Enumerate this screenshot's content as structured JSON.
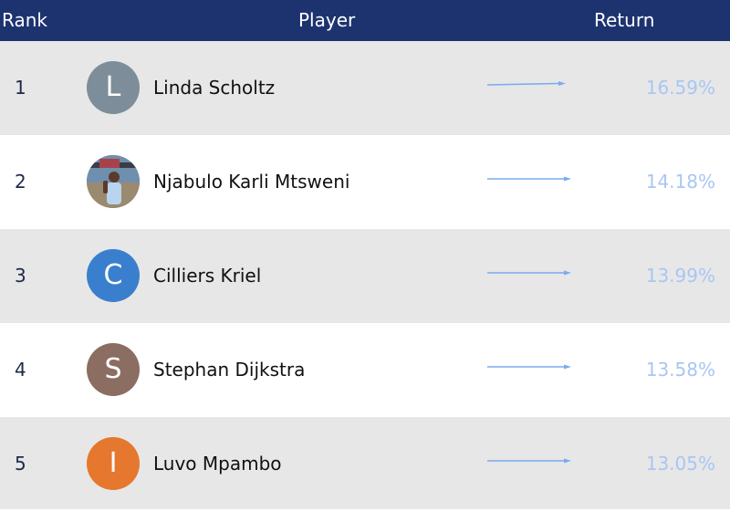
{
  "header": {
    "rank": "Rank",
    "player": "Player",
    "return": "Return"
  },
  "colors": {
    "header_bg": "#1d3370",
    "row_alt": "#e7e7e7",
    "return_text": "#a9c6f3",
    "trend_arrow": "#7aaaf0"
  },
  "players": [
    {
      "rank": "1",
      "name": "Linda Scholtz",
      "return": "16.59%",
      "initial": "L",
      "avatar_color": "#7d8e9a",
      "trend_icon": "trend-right-arrow-icon"
    },
    {
      "rank": "2",
      "name": "Njabulo Karli Mtsweni",
      "return": "14.18%",
      "initial": "",
      "avatar_color": "#8a7a6a",
      "trend_icon": "trend-right-arrow-icon"
    },
    {
      "rank": "3",
      "name": "Cilliers Kriel",
      "return": "13.99%",
      "initial": "C",
      "avatar_color": "#3a7fce",
      "trend_icon": "trend-right-arrow-icon"
    },
    {
      "rank": "4",
      "name": "Stephan Dijkstra",
      "return": "13.58%",
      "initial": "S",
      "avatar_color": "#8b6d62",
      "trend_icon": "trend-right-arrow-icon"
    },
    {
      "rank": "5",
      "name": "Luvo Mpambo",
      "return": "13.05%",
      "initial": "I",
      "avatar_color": "#e6772e",
      "trend_icon": "trend-right-arrow-icon"
    }
  ]
}
